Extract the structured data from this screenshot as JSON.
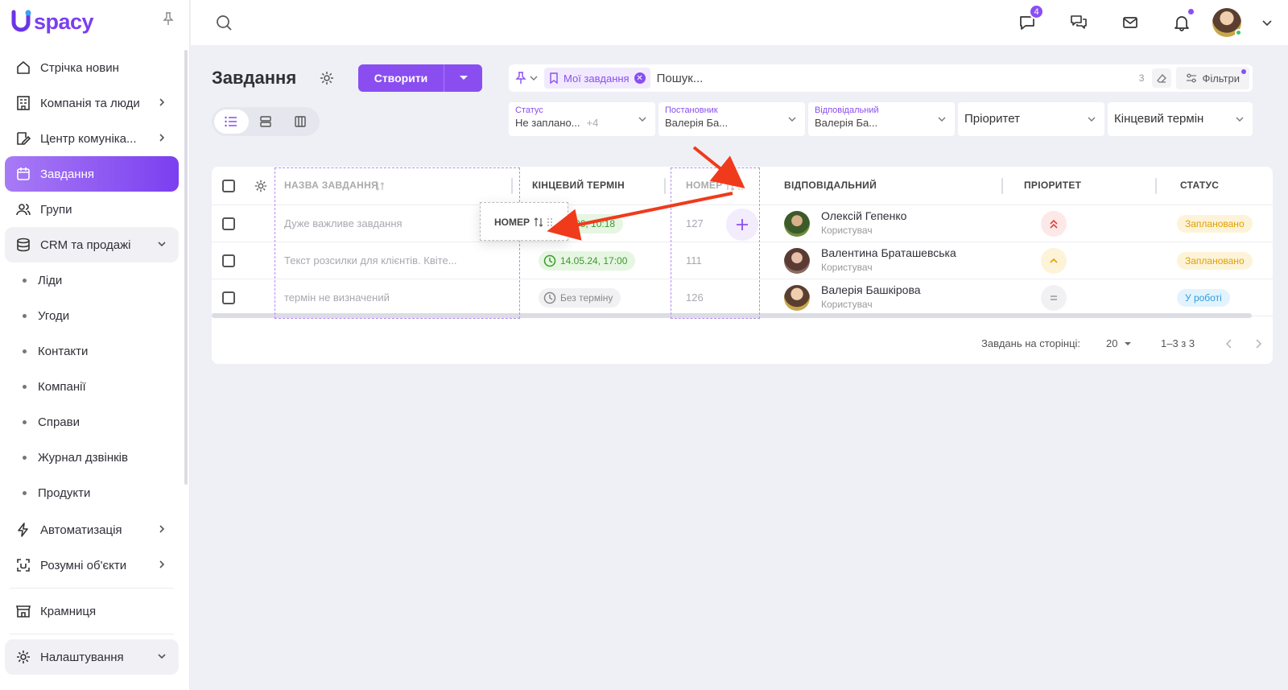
{
  "brand": {
    "logo_text": "spacy"
  },
  "sidebar": {
    "items": [
      {
        "label": "Стрічка новин"
      },
      {
        "label": "Компанія та люди"
      },
      {
        "label": "Центр комуніка..."
      },
      {
        "label": "Завдання"
      },
      {
        "label": "Групи"
      },
      {
        "label": "CRM та продажі"
      },
      {
        "label": "Автоматизація"
      },
      {
        "label": "Розумні об'єкти"
      },
      {
        "label": "Крамниця"
      },
      {
        "label": "Налаштування"
      }
    ],
    "crm_sub": [
      "Ліди",
      "Угоди",
      "Контакти",
      "Компанії",
      "Справи",
      "Журнал дзвінків",
      "Продукти"
    ]
  },
  "topbar": {
    "chat_badge": "4"
  },
  "page": {
    "title": "Завдання",
    "create_label": "Створити"
  },
  "search": {
    "chip_label": "Мої завдання",
    "placeholder": "Пошук...",
    "count": "3",
    "filters_label": "Фільтри"
  },
  "filters": {
    "status_label": "Статус",
    "status_value": "Не заплано...",
    "status_more": "+4",
    "creator_label": "Постановник",
    "creator_value": "Валерія Ба...",
    "responsible_label": "Відповідальний",
    "responsible_value": "Валерія Ба...",
    "priority_label": "Пріоритет",
    "deadline_label": "Кінцевий термін"
  },
  "table": {
    "columns": {
      "name": "НАЗВА ЗАВДАННЯ",
      "deadline": "КІНЦЕВИЙ ТЕРМІН",
      "number": "НОМЕР",
      "responsible": "ВІДПОВІДАЛЬНИЙ",
      "priority": "ПРІОРИТЕТ",
      "status": "СТАТУС"
    },
    "drag_label": "НОМЕР",
    "rows": [
      {
        "name": "Дуже важливе завдання",
        "deadline": "...06, 10:18",
        "number": "127",
        "person": "Олексій Гепенко",
        "role": "Користувач",
        "status": "Заплановано"
      },
      {
        "name": "Текст розсилки для клієнтів. Квіте...",
        "deadline": "14.05.24, 17:00",
        "number": "111",
        "person": "Валентина Браташевська",
        "role": "Користувач",
        "status": "Заплановано"
      },
      {
        "name": "термін не визначений",
        "deadline": "Без терміну",
        "number": "126",
        "person": "Валерія Башкірова",
        "role": "Користувач",
        "status": "У роботі"
      }
    ]
  },
  "pager": {
    "per_page_label": "Завдань на сторінці:",
    "per_page": "20",
    "range": "1–3 з 3"
  },
  "colors": {
    "accent": "#8a4ef0",
    "annotation_arrow": "#f03a1c"
  }
}
